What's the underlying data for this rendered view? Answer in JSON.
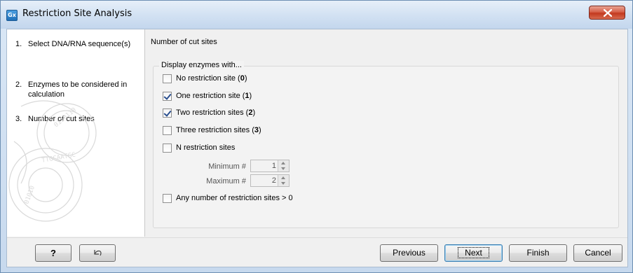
{
  "window": {
    "title": "Restriction Site Analysis",
    "icon": "gx-app-icon"
  },
  "steps": [
    {
      "num": "1.",
      "label": "Select DNA/RNA sequence(s)"
    },
    {
      "num": "2.",
      "label": "Enzymes to be considered in calculation"
    },
    {
      "num": "3.",
      "label": "Number of cut sites"
    }
  ],
  "content": {
    "section_title": "Number of cut sites",
    "group_title": "Display enzymes with...",
    "options": [
      {
        "text": "No restriction site (",
        "count": "0",
        "suffix": ")",
        "checked": false
      },
      {
        "text": "One restriction site (",
        "count": "1",
        "suffix": ")",
        "checked": true
      },
      {
        "text": "Two restriction sites (",
        "count": "2",
        "suffix": ")",
        "checked": true
      },
      {
        "text": "Three restriction sites (",
        "count": "3",
        "suffix": ")",
        "checked": false
      },
      {
        "text": "N restriction sites",
        "count": "",
        "suffix": "",
        "checked": false
      },
      {
        "text": "Any number of restriction sites > 0",
        "count": "",
        "suffix": "",
        "checked": false
      }
    ],
    "minimum": {
      "label": "Minimum #",
      "value": "1"
    },
    "maximum": {
      "label": "Maximum #",
      "value": "2"
    }
  },
  "buttons": {
    "help": "?",
    "reset": "reset-icon",
    "previous": "Previous",
    "next": "Next",
    "finish": "Finish",
    "cancel": "Cancel"
  }
}
